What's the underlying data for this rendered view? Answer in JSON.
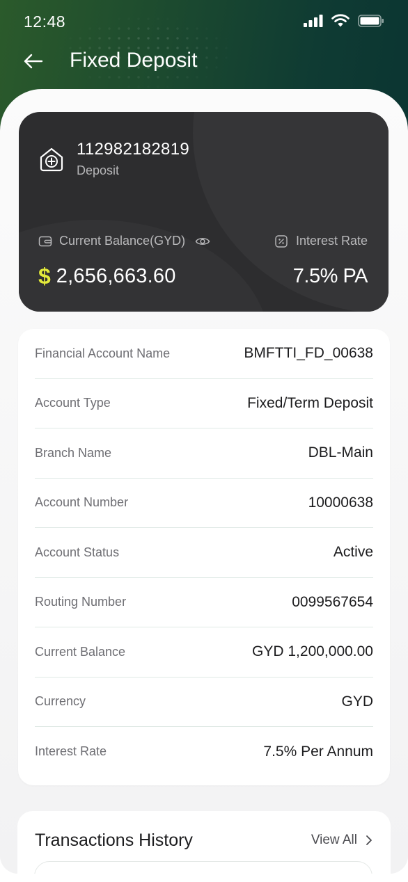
{
  "status_bar": {
    "time": "12:48",
    "icons": [
      "cellular-signal-icon",
      "wifi-icon",
      "battery-icon"
    ]
  },
  "header": {
    "title": "Fixed Deposit",
    "back_icon": "arrow-left-icon",
    "colors": {
      "gradient_start": "#2b5a2b",
      "gradient_end": "#0b3532"
    }
  },
  "balance_card": {
    "account_number": "112982182819",
    "account_type": "Deposit",
    "balance_label": "Current Balance(GYD)",
    "currency_symbol": "$",
    "balance_value": "2,656,663.60",
    "interest_label": "Interest Rate",
    "interest_value": "7.5% PA",
    "colors": {
      "card_bg": "#2d2d2f",
      "currency_symbol": "#e3ea3c"
    }
  },
  "details": [
    {
      "label": "Financial Account Name",
      "value": "BMFTTI_FD_00638"
    },
    {
      "label": "Account Type",
      "value": "Fixed/Term Deposit"
    },
    {
      "label": "Branch Name",
      "value": "DBL-Main"
    },
    {
      "label": "Account Number",
      "value": "10000638"
    },
    {
      "label": "Account Status",
      "value": "Active"
    },
    {
      "label": "Routing Number",
      "value": "0099567654"
    },
    {
      "label": "Current Balance",
      "value": "GYD 1,200,000.00"
    },
    {
      "label": "Currency",
      "value": "GYD"
    },
    {
      "label": "Interest Rate",
      "value": "7.5% Per Annum"
    }
  ],
  "transactions": {
    "title": "Transactions History",
    "view_all": "View All"
  }
}
